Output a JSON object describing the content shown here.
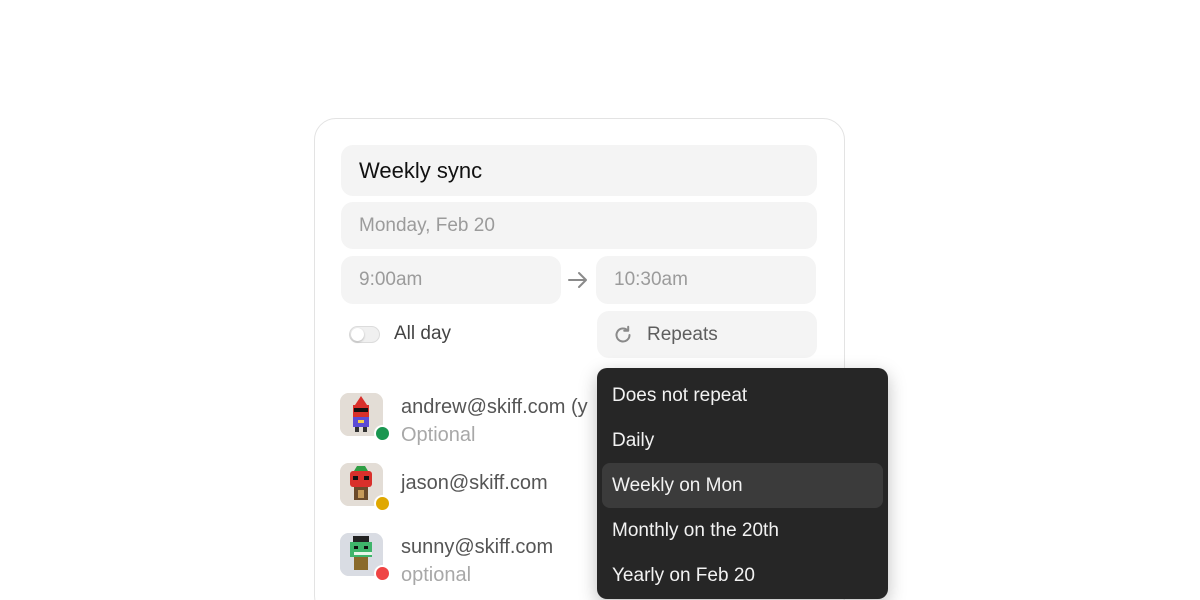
{
  "event": {
    "title": "Weekly sync",
    "date": "Monday, Feb 20",
    "start_time": "9:00am",
    "end_time": "10:30am",
    "all_day_label": "All day",
    "all_day_enabled": false,
    "repeats_label": "Repeats"
  },
  "icons": {
    "time_separator": "arrow-right-icon",
    "repeats": "refresh-icon"
  },
  "guests": [
    {
      "email": "andrew@skiff.com (y",
      "subtitle": "Optional",
      "status_color": "#1a9650",
      "avatar_color": "#e3ddd6"
    },
    {
      "email": "jason@skiff.com",
      "subtitle": "",
      "status_color": "#e0a800",
      "avatar_color": "#e3ddd6"
    },
    {
      "email": "sunny@skiff.com",
      "subtitle": "optional",
      "status_color": "#ef4444",
      "avatar_color": "#d9dce3"
    }
  ],
  "repeat_menu": {
    "options": [
      "Does not repeat",
      "Daily",
      "Weekly on Mon",
      "Monthly on the 20th",
      "Yearly on Feb 20"
    ],
    "selected": "Weekly on Mon"
  },
  "colors": {
    "menu_background": "#262626",
    "menu_selected": "#3b3b3b",
    "field_background": "#f4f4f4"
  }
}
